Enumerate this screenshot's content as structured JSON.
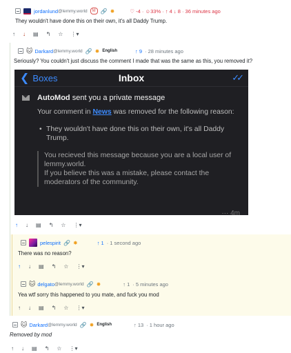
{
  "c1": {
    "username": "jordanlund",
    "instance": "@lemmy.world",
    "badge": "M",
    "score": "♡ -4 · ☺33% · ↑ 4 ↓ 8 · 36 minutes ago",
    "text": "They wouldn't have done this on their own, it's all Daddy Trump."
  },
  "c2": {
    "username": "Darkard",
    "instance": "@lemmy.world",
    "lang": "English",
    "score": "↑ 9",
    "time": "· 28 minutes ago",
    "text": "Seriously? You couldn't just discuss the comment I made that was the same as this, you removed it?"
  },
  "shot": {
    "back": "Boxes",
    "title": "Inbox",
    "header_pre": "AutoMod",
    "header_post": " sent you a private message",
    "p1_pre": "Your comment in ",
    "p1_link": "News",
    "p1_post": " was removed for the following reason:",
    "bullet": "They wouldn't have done this on their own, it's all Daddy Trump.",
    "quote1": "You recieved this message because you are a local user of lemmy.world.",
    "quote2": "If you believe this was a mistake, please contact the moderators of the community.",
    "timestamp": "··· 4m"
  },
  "c3": {
    "username": "pelespirit",
    "score": "↑ 1",
    "time": "· 1 second ago",
    "text": "There was no reason?"
  },
  "c4": {
    "username": "delgato",
    "instance": "@lemmy.world",
    "score": "↑ 1",
    "time": "· 5 minutes ago",
    "text": "Yea wtf sorry this happened to you mate, and fuck you mod"
  },
  "c5": {
    "username": "Darkard",
    "instance": "@lemmy.world",
    "lang": "English",
    "score": "↑ 13",
    "time": "· 1 hour ago",
    "text": "Removed by mod"
  },
  "icons": {
    "up": "↑",
    "down": "↓",
    "save": "▤",
    "reply": "↰",
    "star": "☆",
    "more": "⋮▾",
    "link": "🔗",
    "mod": "✸"
  },
  "colors": {
    "accent": "#0d6efd",
    "downvote": "#b02a10",
    "reply_bg": "#fdfbea"
  }
}
